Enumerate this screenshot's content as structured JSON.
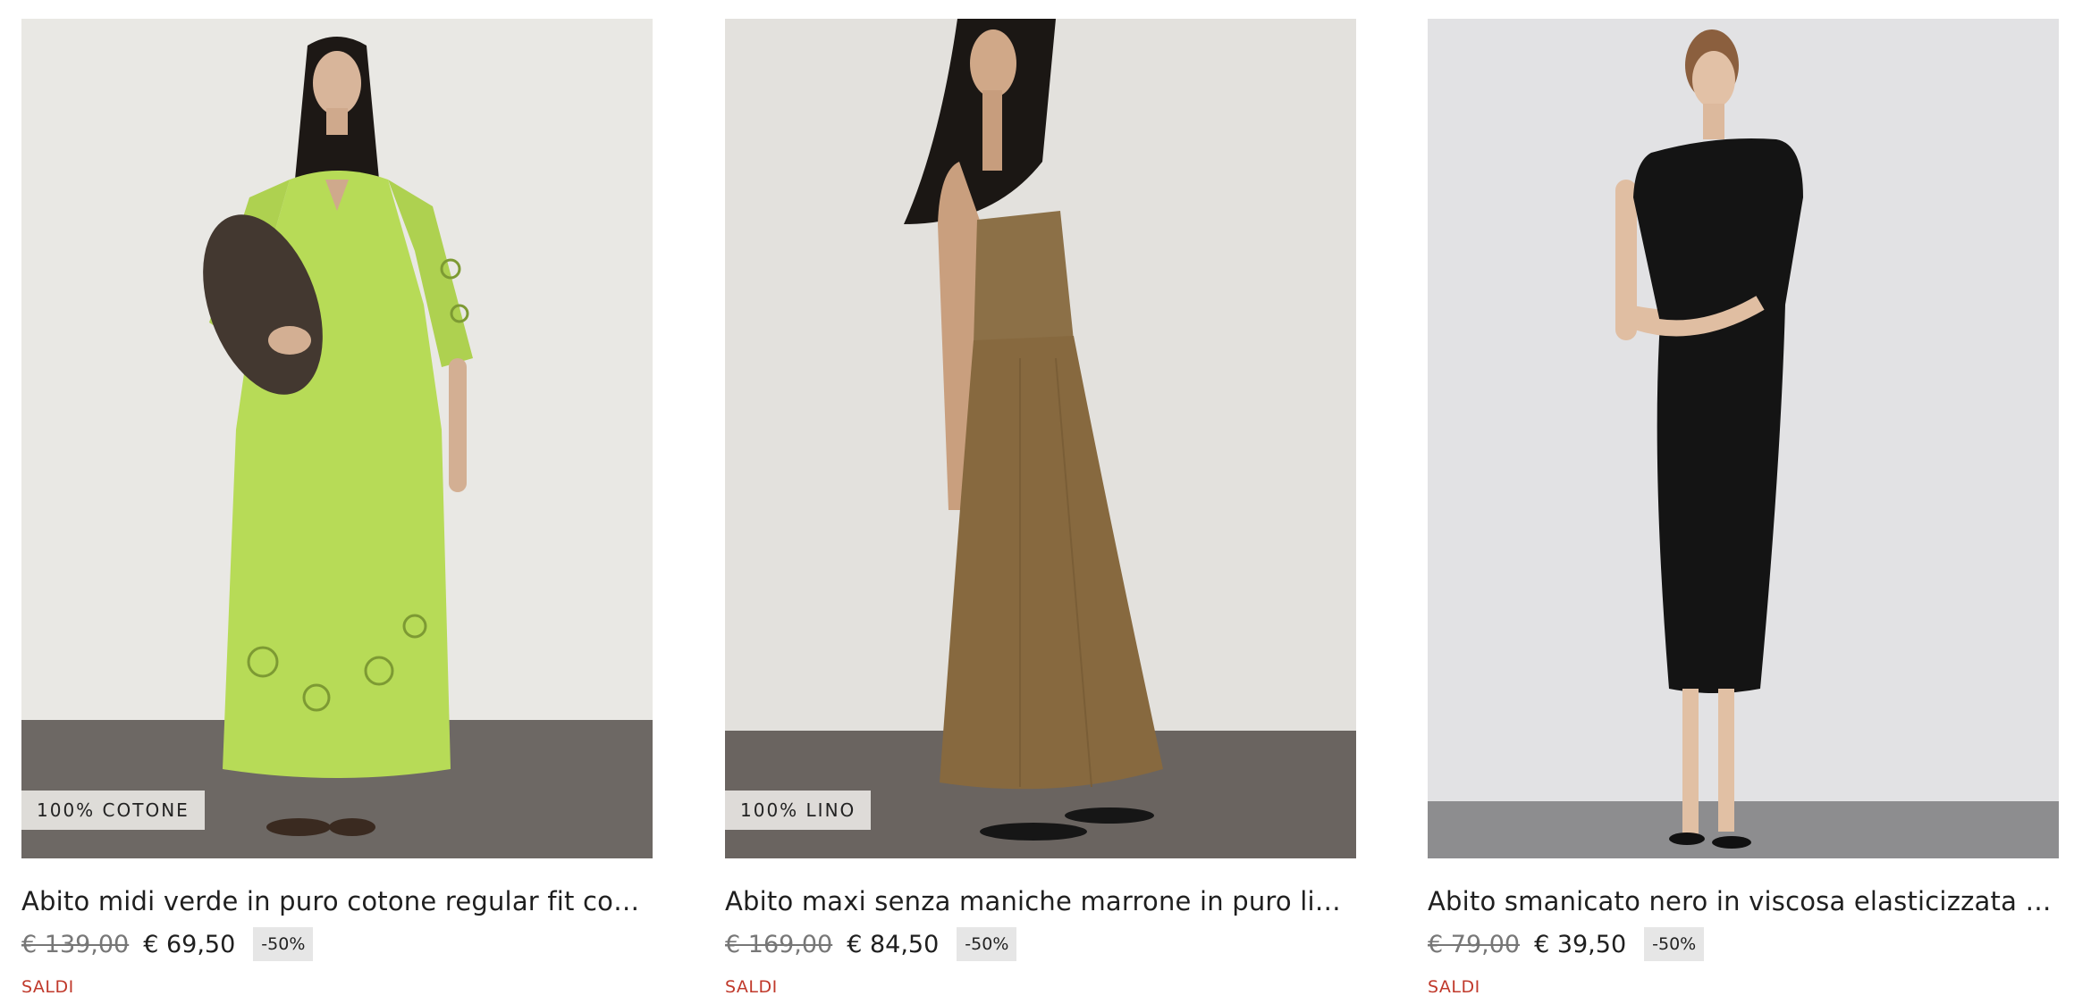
{
  "products": [
    {
      "badge": "100% COTONE",
      "title": "Abito midi verde in puro cotone regular fit con ricami…",
      "old_price": "€ 139,00",
      "price": "€ 69,50",
      "discount": "-50%",
      "tag": "SALDI",
      "dress_color": "#b7db57"
    },
    {
      "badge": "100% LINO",
      "title": "Abito maxi senza maniche marrone in puro lino regul…",
      "old_price": "€ 169,00",
      "price": "€ 84,50",
      "discount": "-50%",
      "tag": "SALDI",
      "dress_color": "#8c7047"
    },
    {
      "badge": "",
      "title": "Abito smanicato nero in viscosa elasticizzata slim fit",
      "old_price": "€ 79,00",
      "price": "€ 39,50",
      "discount": "-50%",
      "tag": "SALDI",
      "dress_color": "#141414"
    }
  ],
  "colors": {
    "sale_red": "#c0392b"
  }
}
